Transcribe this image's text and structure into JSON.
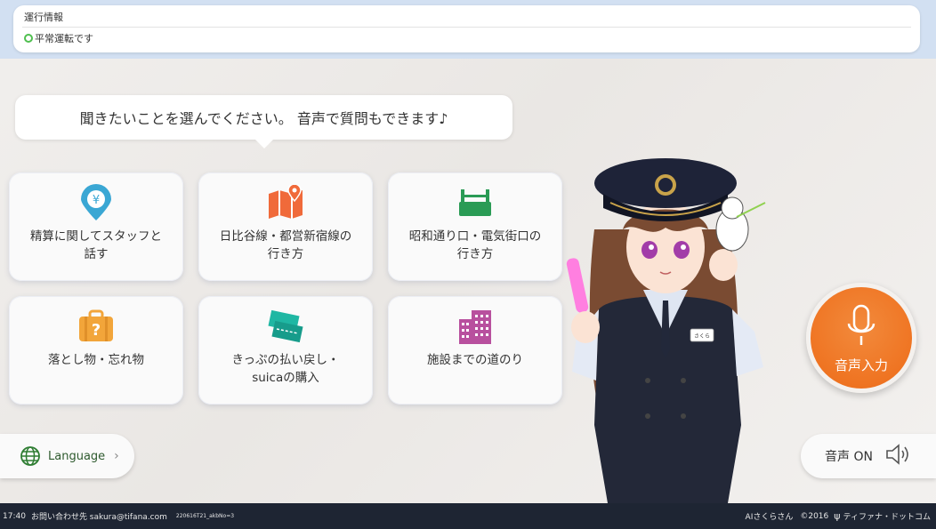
{
  "status": {
    "title": "運行情報",
    "message": "平常運転です"
  },
  "prompt": "聞きたいことを選んでください。 音声で質問もできます♪",
  "tiles": [
    {
      "label": "精算に関してスタッフと\n話す",
      "icon": "yen-pin-icon",
      "color": "#3aa7d4"
    },
    {
      "label": "日比谷線・都営新宿線の\n行き方",
      "icon": "map-icon",
      "color": "#f06a3a"
    },
    {
      "label": "昭和通り口・電気街口の\n行き方",
      "icon": "ticket-gate-icon",
      "color": "#2a9b55"
    },
    {
      "label": "落とし物・忘れ物",
      "icon": "lost-item-bag-icon",
      "color": "#f2a53a"
    },
    {
      "label": "きっぷの払い戻し・\nsuicaの購入",
      "icon": "tickets-icon",
      "color": "#1fb7a3"
    },
    {
      "label": "施設までの道のり",
      "icon": "buildings-icon",
      "color": "#b8509e"
    }
  ],
  "language_button": {
    "label": "Language",
    "icon": "globe-icon"
  },
  "voice_input": {
    "label": "音声入力",
    "icon": "microphone-icon"
  },
  "sound_toggle": {
    "label": "音声 ON",
    "icon": "speaker-icon"
  },
  "character": {
    "badge": "さくら"
  },
  "footer": {
    "time": "17:40",
    "contact": "お問い合わせ先 sakura@tifana.com",
    "build": "220616T21_akbNo=3",
    "product": "AIさくらさん",
    "copyright": "©2016",
    "company": "ティファナ・ドットコム"
  }
}
